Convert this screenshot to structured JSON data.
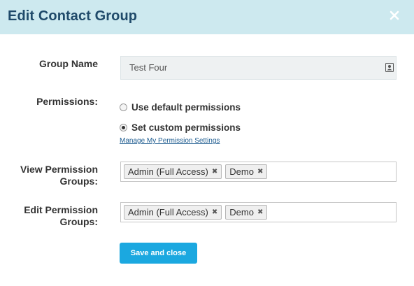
{
  "dialog": {
    "title": "Edit Contact Group",
    "close_icon": "close-icon"
  },
  "group_name": {
    "label": "Group Name",
    "value": "Test Four",
    "icon": "contact-card-icon"
  },
  "permissions": {
    "label": "Permissions:",
    "options": [
      {
        "label": "Use default permissions",
        "checked": false
      },
      {
        "label": "Set custom permissions",
        "checked": true
      }
    ],
    "settings_link": "Manage My Permission Settings"
  },
  "view_permission_groups": {
    "label_line1": "View Permission",
    "label_line2": "Groups:",
    "tags": [
      "Admin (Full Access)",
      "Demo"
    ]
  },
  "edit_permission_groups": {
    "label_line1": "Edit Permission",
    "label_line2": "Groups:",
    "tags": [
      "Admin (Full Access)",
      "Demo"
    ]
  },
  "save_button": {
    "label": "Save and close"
  },
  "colors": {
    "header_bg": "#cde9ef",
    "title": "#1f4a6a",
    "button": "#1ba8e0",
    "link": "#1f5d91"
  }
}
